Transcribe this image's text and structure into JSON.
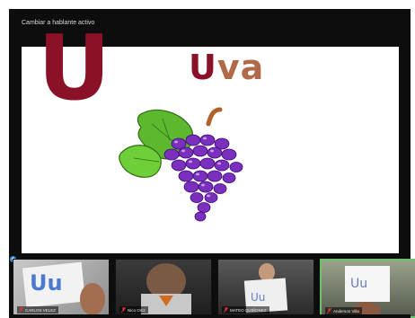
{
  "window": {
    "active_speaker_button": "Cambiar a hablante activo"
  },
  "slide": {
    "big_letter": "U",
    "word_first_letter": "U",
    "word_rest": "va",
    "colors": {
      "letter": "#8b1128",
      "rest": "#b06a4a",
      "grape": "#7a2fbf"
    }
  },
  "participants": [
    {
      "name": "CARLOS VELEZ",
      "muted": true,
      "active": false
    },
    {
      "name": "Nico Ortiz",
      "muted": true,
      "active": false
    },
    {
      "name": "MATEO QUIÑONEZ",
      "muted": true,
      "active": false
    },
    {
      "name": "Anderson Villa",
      "muted": true,
      "active": true
    }
  ],
  "icons": {
    "mute": "mic-muted-icon"
  }
}
